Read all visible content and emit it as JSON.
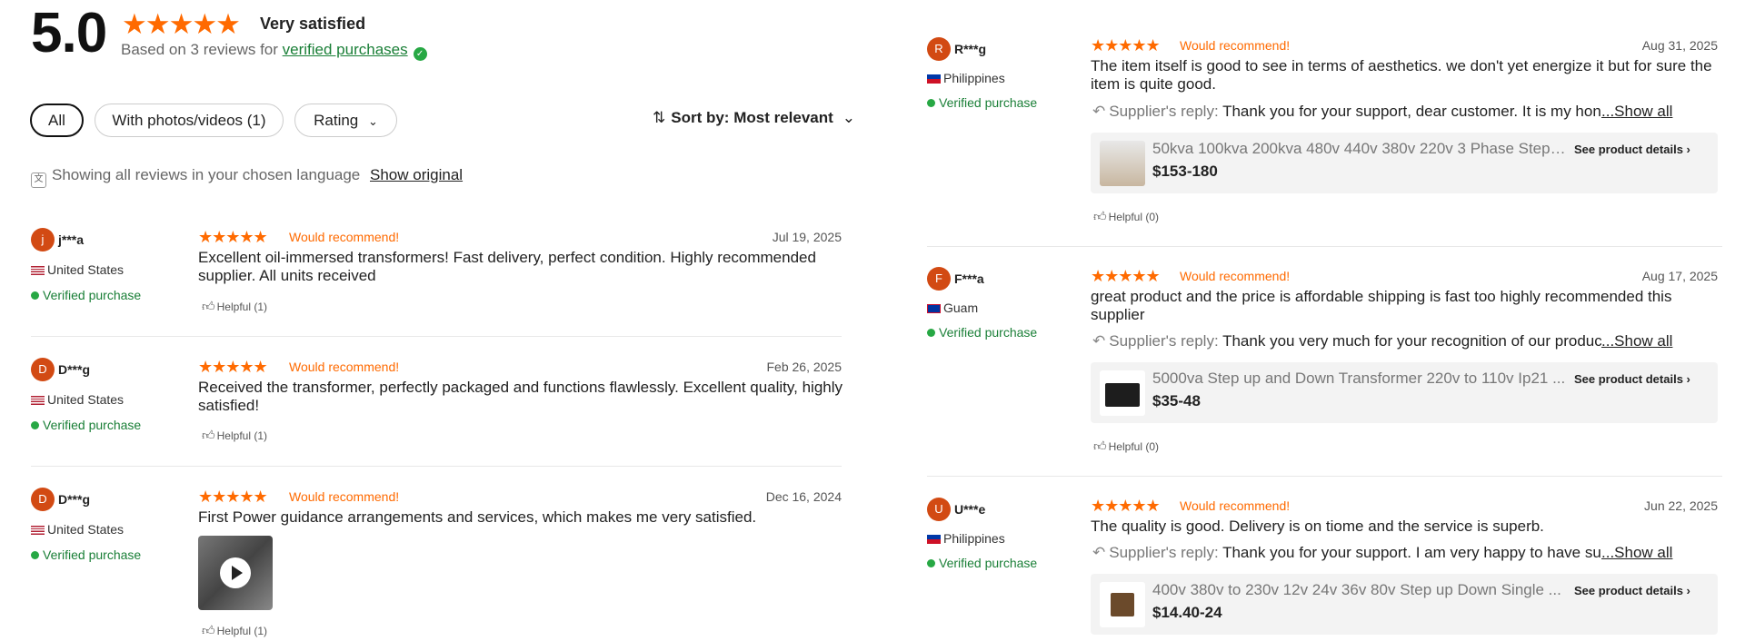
{
  "summary": {
    "score": "5.0",
    "stars": "★★★★★",
    "label": "Very satisfied",
    "based_prefix": "Based on 3 reviews for",
    "based_link": "verified purchases"
  },
  "filters": {
    "all": "All",
    "photos": "With photos/videos (1)",
    "rating": "Rating",
    "sort": "Sort by: Most relevant"
  },
  "language_note": {
    "text": "Showing all reviews in your chosen language",
    "show_original": "Show original"
  },
  "colors": {
    "accent": "#ff6a00",
    "verified": "#1a7f37",
    "avatar": "#d24a13"
  },
  "common": {
    "stars": "★★★★★",
    "recommend": "Would recommend!",
    "verified": "Verified purchase",
    "reply_label": "Supplier's reply:",
    "show_all": "...Show all",
    "see_details": "See product details"
  },
  "left_reviews": [
    {
      "initial": "j",
      "user": "j***a",
      "country": "United States",
      "date": "Jul 19, 2025",
      "text": "Excellent oil-immersed transformers! Fast delivery, perfect condition. Highly recommended supplier. All units received",
      "helpful": "Helpful (1)"
    },
    {
      "initial": "D",
      "user": "D***g",
      "country": "United States",
      "date": "Feb 26, 2025",
      "text": "Received the transformer, perfectly packaged and functions flawlessly. Excellent quality, highly satisfied!",
      "helpful": "Helpful (1)"
    },
    {
      "initial": "D",
      "user": "D***g",
      "country": "United States",
      "date": "Dec 16, 2024",
      "text": "First Power guidance arrangements and services, which makes me very satisfied.",
      "helpful": "Helpful (1)"
    }
  ],
  "right_reviews": [
    {
      "initial": "R",
      "user": "R***g",
      "country": "Philippines",
      "date": "Aug 31, 2025",
      "text": "The item itself is good to see in terms of aesthetics. we don't yet energize it but for sure the item is quite good.",
      "reply": "Thank you for your support, dear customer. It is my hono",
      "product_name": "50kva 100kva 200kva 480v 440v 380v 220v 3 Phase Step ...",
      "product_price": "$153-180",
      "helpful": "Helpful (0)"
    },
    {
      "initial": "F",
      "user": "F***a",
      "country": "Guam",
      "date": "Aug 17, 2025",
      "text": "great product and the price is affordable shipping is fast too highly recommended this supplier",
      "reply": "Thank you very much for your recognition of our produc",
      "product_name": "5000va Step up and Down Transformer 220v to 110v Ip21 ...",
      "product_price": "$35-48",
      "helpful": "Helpful (0)"
    },
    {
      "initial": "U",
      "user": "U***e",
      "country": "Philippines",
      "date": "Jun 22, 2025",
      "text": "The quality is good. Delivery is on tiome and the service is superb.",
      "reply": "Thank you for your support. I am very happy to have suc",
      "product_name": "400v 380v to 230v 12v 24v 36v 80v Step up Down Single ...",
      "product_price": "$14.40-24"
    }
  ]
}
